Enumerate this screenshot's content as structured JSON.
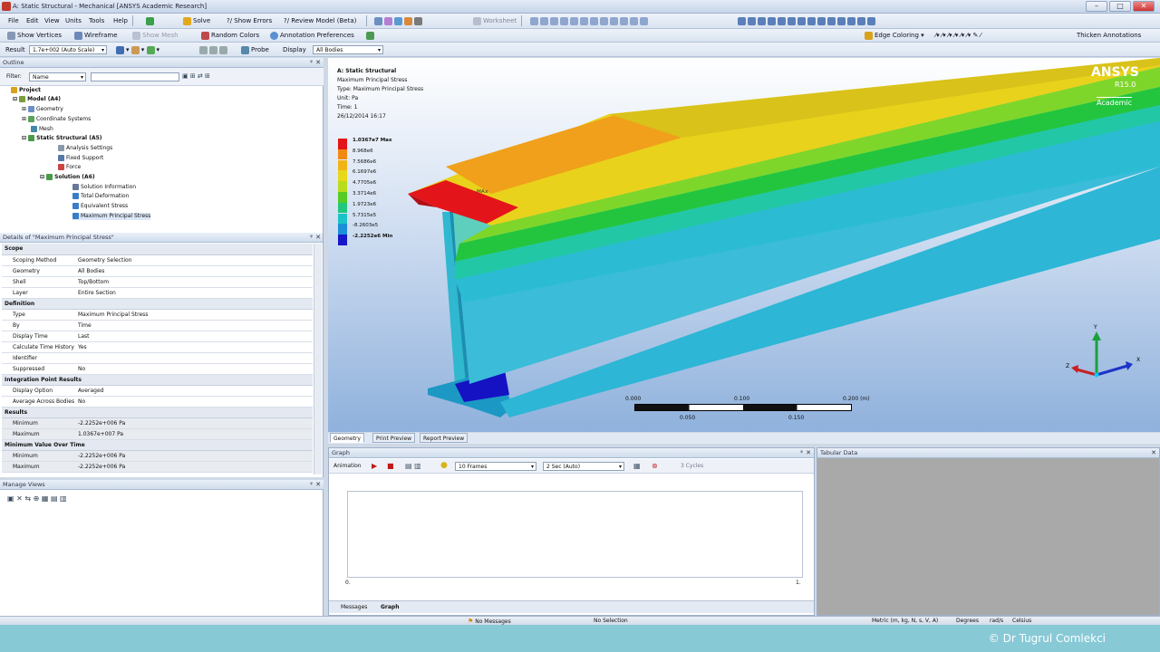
{
  "window": {
    "title": "A: Static Structural - Mechanical [ANSYS Academic Research]"
  },
  "menu": [
    "File",
    "Edit",
    "View",
    "Units",
    "Tools",
    "Help"
  ],
  "toolbar1": {
    "solve": "Solve",
    "show_errors": "?/ Show Errors",
    "review_model": "?/ Review Model (Beta)",
    "worksheet": "Worksheet"
  },
  "toolbar2": {
    "show_vertices": "Show Vertices",
    "wireframe": "Wireframe",
    "show_mesh": "Show Mesh",
    "random_colors": "Random Colors",
    "annotation_prefs": "Annotation Preferences",
    "edge_coloring": "Edge Coloring",
    "thicken_annotations": "Thicken Annotations"
  },
  "toolbar3": {
    "result_label": "Result",
    "result_scale": "1.7e+002 (Auto Scale)",
    "probe": "Probe",
    "display_label": "Display",
    "display_value": "All Bodies"
  },
  "outline": {
    "title": "Outline",
    "filter_label": "Filter:",
    "filter_value": "Name",
    "items": [
      "Project",
      "Model (A4)",
      "Geometry",
      "Coordinate Systems",
      "Mesh",
      "Static Structural (A5)",
      "Analysis Settings",
      "Fixed Support",
      "Force",
      "Solution (A6)",
      "Solution Information",
      "Total Deformation",
      "Equivalent Stress",
      "Maximum Principal Stress"
    ]
  },
  "details": {
    "title": "Details of \"Maximum Principal Stress\"",
    "rows": [
      {
        "cat": "Scope"
      },
      {
        "k": "Scoping Method",
        "v": "Geometry Selection"
      },
      {
        "k": "Geometry",
        "v": "All Bodies"
      },
      {
        "k": "Shell",
        "v": "Top/Bottom"
      },
      {
        "k": "Layer",
        "v": "Entire Section"
      },
      {
        "cat": "Definition"
      },
      {
        "k": "Type",
        "v": "Maximum Principal Stress"
      },
      {
        "k": "By",
        "v": "Time"
      },
      {
        "k": "Display Time",
        "v": "Last"
      },
      {
        "k": "Calculate Time History",
        "v": "Yes"
      },
      {
        "k": "Identifier",
        "v": ""
      },
      {
        "k": "Suppressed",
        "v": "No"
      },
      {
        "cat": "Integration Point Results"
      },
      {
        "k": "Display Option",
        "v": "Averaged"
      },
      {
        "k": "Average Across Bodies",
        "v": "No"
      },
      {
        "cat": "Results"
      },
      {
        "k": "Minimum",
        "v": "-2.2252e+006 Pa"
      },
      {
        "k": "Maximum",
        "v": "1.0367e+007 Pa"
      },
      {
        "cat": "Minimum Value Over Time"
      },
      {
        "k": "Minimum",
        "v": "-2.2252e+006 Pa"
      },
      {
        "k": "Maximum",
        "v": "-2.2252e+006 Pa"
      }
    ]
  },
  "manage_views": {
    "title": "Manage Views"
  },
  "viewport": {
    "info": [
      "A: Static Structural",
      "Maximum Principal Stress",
      "Type: Maximum Principal Stress",
      "Unit: Pa",
      "Time: 1",
      "26/12/2014 16:17"
    ],
    "legend": [
      "1.0367e7 Max",
      "8.968e6",
      "7.5686e6",
      "6.1697e6",
      "4.7705e6",
      "3.3714e6",
      "1.9723e6",
      "5.7315e5",
      "-8.2603e5",
      "-2.2252e6 Min"
    ],
    "legend_colors": [
      "#e3151a",
      "#f08a13",
      "#f0b514",
      "#e8d81a",
      "#b9dc1c",
      "#54cc25",
      "#21c77c",
      "#1cc3c6",
      "#1b8fd8",
      "#1517c8"
    ],
    "brand": "ANSYS",
    "version": "R15.0",
    "edition": "Academic",
    "scale_top": [
      "0.000",
      "0.100",
      "0.200 (m)"
    ],
    "scale_bottom": [
      "0.050",
      "0.150"
    ],
    "axes": {
      "y": "Y",
      "x": "X",
      "z": "Z"
    }
  },
  "view_tabs": [
    "Geometry",
    "Print Preview",
    "Report Preview"
  ],
  "graph": {
    "title": "Graph",
    "animation_label": "Animation",
    "frames": "10 Frames",
    "speed": "2 Sec (Auto)",
    "cycles": "3 Cycles",
    "x_start": "0.",
    "x_end": "1.",
    "bottom_tabs": [
      "Messages",
      "Graph"
    ]
  },
  "tabular": {
    "title": "Tabular Data"
  },
  "status": {
    "messages": "No Messages",
    "selection": "No Selection",
    "units": "Metric (m, kg, N, s, V, A)",
    "angle": "Degrees",
    "rate": "rad/s",
    "temp": "Celsius"
  },
  "footer": {
    "credit": "© Dr Tugrul Comlekci"
  }
}
